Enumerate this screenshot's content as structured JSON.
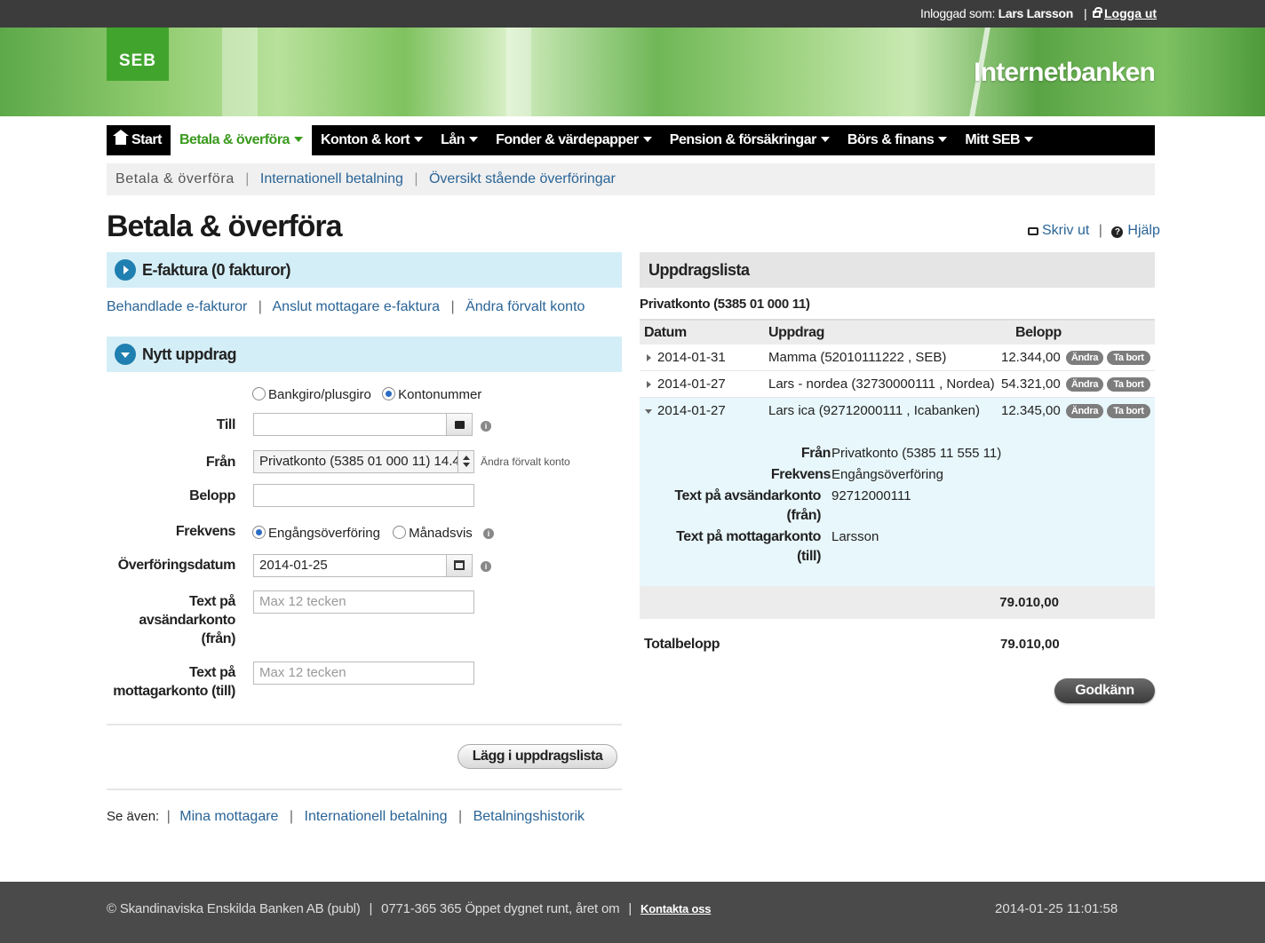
{
  "topbar": {
    "logged_in_label": "Inloggad som:",
    "user_name": "Lars Larsson",
    "logout": "Logga ut"
  },
  "brand": {
    "logo_text": "SEB",
    "title": "Internetbanken"
  },
  "nav": [
    {
      "label": "Start"
    },
    {
      "label": "Betala & överföra"
    },
    {
      "label": "Konton & kort"
    },
    {
      "label": "Lån"
    },
    {
      "label": "Fonder & värdepapper"
    },
    {
      "label": "Pension & försäkringar"
    },
    {
      "label": "Börs & finans"
    },
    {
      "label": "Mitt SEB"
    }
  ],
  "breadcrumb": {
    "current": "Betala & överföra",
    "links": [
      "Internationell betalning",
      "Översikt stående överföringar"
    ]
  },
  "page": {
    "title": "Betala & överföra",
    "print": "Skriv ut",
    "help": "Hjälp"
  },
  "efaktura": {
    "heading": "E-faktura (0 fakturor)",
    "links": [
      "Behandlade e-fakturor",
      "Anslut mottagare e-faktura",
      "Ändra förvalt konto"
    ]
  },
  "new_order": {
    "heading": "Nytt uppdrag",
    "type_options": [
      "Bankgiro/plusgiro",
      "Kontonummer"
    ],
    "type_selected": "Kontonummer",
    "to_label": "Till",
    "to_value": "",
    "from_label": "Från",
    "from_value": "Privatkonto (5385 01 000 11) 14.4",
    "from_hint": "Ändra förvalt konto",
    "amount_label": "Belopp",
    "amount_value": "",
    "freq_label": "Frekvens",
    "freq_options": [
      "Engångsöverföring",
      "Månadsvis"
    ],
    "freq_selected": "Engångsöverföring",
    "date_label": "Överföringsdatum",
    "date_value": "2014-01-25",
    "sender_text_label_1": "Text på",
    "sender_text_label_2": "avsändarkonto",
    "sender_text_label_3": "(från)",
    "sender_text_placeholder": "Max 12 tecken",
    "receiver_text_label_1": "Text på",
    "receiver_text_label_2": "mottagarkonto (till)",
    "receiver_text_placeholder": "Max 12 tecken",
    "add_button": "Lägg i uppdragslista"
  },
  "see_also": {
    "label": "Se även:",
    "links": [
      "Mina mottagare",
      "Internationell betalning",
      "Betalningshistorik"
    ]
  },
  "orders": {
    "heading": "Uppdragslista",
    "account": "Privatkonto (5385 01 000 11)",
    "columns": [
      "Datum",
      "Uppdrag",
      "Belopp"
    ],
    "rows": [
      {
        "date": "2014-01-31",
        "desc": "Mamma (52010111222 , SEB)",
        "amount": "12.344,00"
      },
      {
        "date": "2014-01-27",
        "desc": "Lars - nordea (32730000111 , Nordea)",
        "amount": "54.321,00"
      },
      {
        "date": "2014-01-27",
        "desc": "Lars ica (92712000111 , Icabanken)",
        "amount": "12.345,00"
      }
    ],
    "edit_label": "Ändra",
    "remove_label": "Ta bort",
    "detail": {
      "from_label": "Från",
      "from_value": "Privatkonto (5385 11 555 11)",
      "freq_label": "Frekvens",
      "freq_value": "Engångsöverföring",
      "sender_label_1": "Text på avsändarkonto",
      "sender_label_2": "(från)",
      "sender_value": "92712000111",
      "receiver_label_1": "Text på mottagarkonto",
      "receiver_label_2": "(till)",
      "receiver_value": "Larsson"
    },
    "subtotal": "79.010,00",
    "total_label": "Totalbelopp",
    "total_value": "79.010,00",
    "approve": "Godkänn"
  },
  "footer": {
    "copyright": "© Skandinaviska Enskilda Banken AB (publ)",
    "phone": "0771-365 365 Öppet dygnet runt, året om",
    "contact": "Kontakta oss",
    "timestamp": "2014-01-25 11:01:58"
  },
  "colors": {
    "brand_green": "#41a52d",
    "link_blue": "#2a6496",
    "section_blue": "#d4eef7",
    "nav_black": "#000000"
  }
}
